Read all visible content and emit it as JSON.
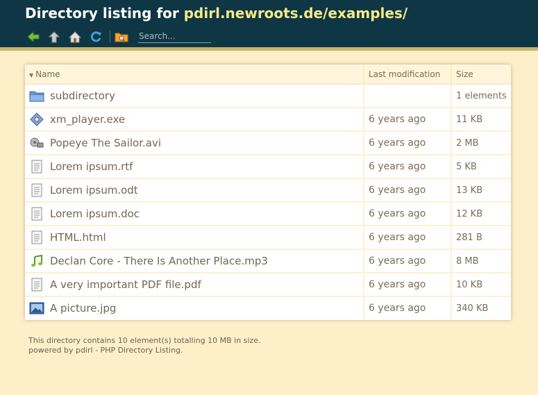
{
  "header": {
    "title_prefix": "Directory listing for ",
    "title_url": "pdirl.newroots.de/examples/",
    "search_placeholder": "Search..."
  },
  "table": {
    "columns": {
      "name": "Name",
      "modified": "Last modification",
      "size": "Size"
    },
    "rows": [
      {
        "icon": "folder-icon",
        "name": "subdirectory",
        "modified": "",
        "size": "1 elements"
      },
      {
        "icon": "executable-icon",
        "name": "xm_player.exe",
        "modified": "6 years ago",
        "size": "11 KB"
      },
      {
        "icon": "video-icon",
        "name": "Popeye The Sailor.avi",
        "modified": "6 years ago",
        "size": "2 MB"
      },
      {
        "icon": "document-icon",
        "name": "Lorem ipsum.rtf",
        "modified": "6 years ago",
        "size": "5 KB"
      },
      {
        "icon": "document-icon",
        "name": "Lorem ipsum.odt",
        "modified": "6 years ago",
        "size": "13 KB"
      },
      {
        "icon": "document-icon",
        "name": "Lorem ipsum.doc",
        "modified": "6 years ago",
        "size": "12 KB"
      },
      {
        "icon": "document-icon",
        "name": "HTML.html",
        "modified": "6 years ago",
        "size": "281 B"
      },
      {
        "icon": "music-icon",
        "name": "Declan Core - There Is Another Place.mp3",
        "modified": "6 years ago",
        "size": "8 MB"
      },
      {
        "icon": "document-icon",
        "name": "A very important PDF file.pdf",
        "modified": "6 years ago",
        "size": "10 KB"
      },
      {
        "icon": "picture-icon",
        "name": "A picture.jpg",
        "modified": "6 years ago",
        "size": "340 KB"
      }
    ]
  },
  "footer": {
    "summary": "This directory contains 10 element(s) totalling 10 MB in size.",
    "powered": "powered by pdirl - PHP Directory Listing."
  }
}
